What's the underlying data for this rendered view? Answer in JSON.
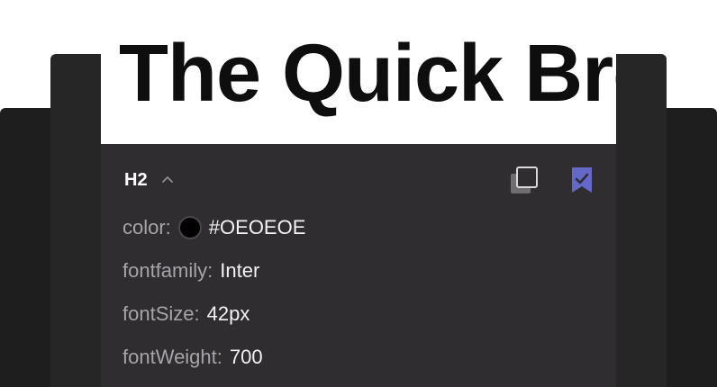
{
  "preview": {
    "sample_text": "The Quick Bro"
  },
  "panel": {
    "tag": "H2",
    "icons": {
      "collapse": "chevron-up-icon",
      "copy": "copy-icon",
      "save": "bookmark-check-icon"
    },
    "accent_color": "#6468c8",
    "properties": {
      "color": {
        "key": "color:",
        "value": "#OEOEOE",
        "swatch": "#000000"
      },
      "fontfamily": {
        "key": "fontfamily:",
        "value": "Inter"
      },
      "fontSize": {
        "key": "fontSize:",
        "value": "42px"
      },
      "fontWeight": {
        "key": "fontWeight:",
        "value": "700"
      }
    }
  }
}
